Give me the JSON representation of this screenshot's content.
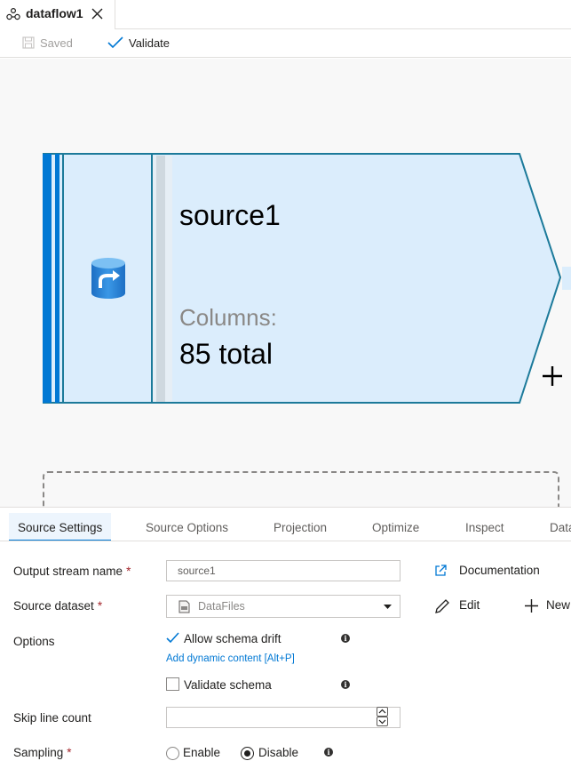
{
  "document_tab": {
    "title": "dataflow1",
    "icon": "dataflow-icon"
  },
  "toolbar": {
    "saved_label": "Saved",
    "validate_label": "Validate"
  },
  "canvas": {
    "node": {
      "name": "source1",
      "columns_label": "Columns:",
      "columns_value": "85 total",
      "icon": "source-database-icon"
    }
  },
  "panel": {
    "tabs": [
      {
        "label": "Source Settings",
        "active": true
      },
      {
        "label": "Source Options"
      },
      {
        "label": "Projection"
      },
      {
        "label": "Optimize"
      },
      {
        "label": "Inspect"
      },
      {
        "label": "Data"
      }
    ],
    "output_stream": {
      "label": "Output stream name",
      "required": "*",
      "value": "source1"
    },
    "source_dataset": {
      "label": "Source dataset",
      "required": "*",
      "value": "DataFiles"
    },
    "options": {
      "label": "Options",
      "allow_schema_drift": {
        "label": "Allow schema drift",
        "checked": true
      },
      "dynamic_content_link": "Add dynamic content [Alt+P]",
      "validate_schema": {
        "label": "Validate schema",
        "checked": false
      }
    },
    "skip_line_count": {
      "label": "Skip line count",
      "value": ""
    },
    "sampling": {
      "label": "Sampling",
      "required": "*",
      "options": [
        {
          "label": "Enable"
        },
        {
          "label": "Disable"
        }
      ],
      "selected": "Disable"
    },
    "actions": {
      "documentation": "Documentation",
      "edit": "Edit",
      "new": "New"
    }
  },
  "colors": {
    "accent": "#0078d4",
    "node_fill": "#dbedfc",
    "node_stroke": "#1c7a9a"
  }
}
